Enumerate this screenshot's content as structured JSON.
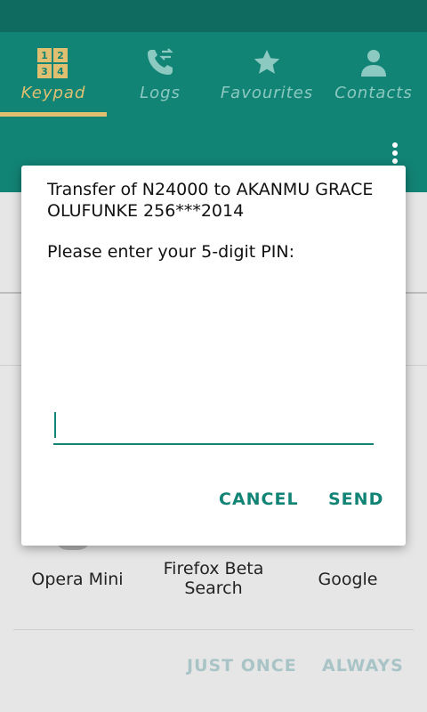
{
  "status_bar": {},
  "tabs": [
    {
      "label": "Keypad",
      "icon": "keypad-icon",
      "active": true,
      "digits": [
        "1",
        "2",
        "3",
        "4"
      ]
    },
    {
      "label": "Logs",
      "icon": "call-log-icon",
      "active": false
    },
    {
      "label": "Favourites",
      "icon": "star-icon",
      "active": false
    },
    {
      "label": "Contacts",
      "icon": "person-icon",
      "active": false
    }
  ],
  "overflow_icon": "more-vert-icon",
  "dialog": {
    "message": "Transfer of N24000 to AKANMU GRACE OLUFUNKE 256***2014",
    "prompt": "Please enter your 5-digit PIN:",
    "pin_value": "",
    "cancel_label": "CANCEL",
    "send_label": "SEND"
  },
  "chooser": {
    "apps": [
      {
        "label": "Opera Mini"
      },
      {
        "label": "Firefox Beta Search"
      },
      {
        "label": "Google"
      }
    ],
    "just_once_label": "JUST ONCE",
    "always_label": "ALWAYS"
  },
  "colors": {
    "header": "#128476",
    "status_bar": "#0f6b60",
    "accent": "#e0c070",
    "dialog_button": "#128476",
    "disabled_button": "#a9c4c6"
  }
}
